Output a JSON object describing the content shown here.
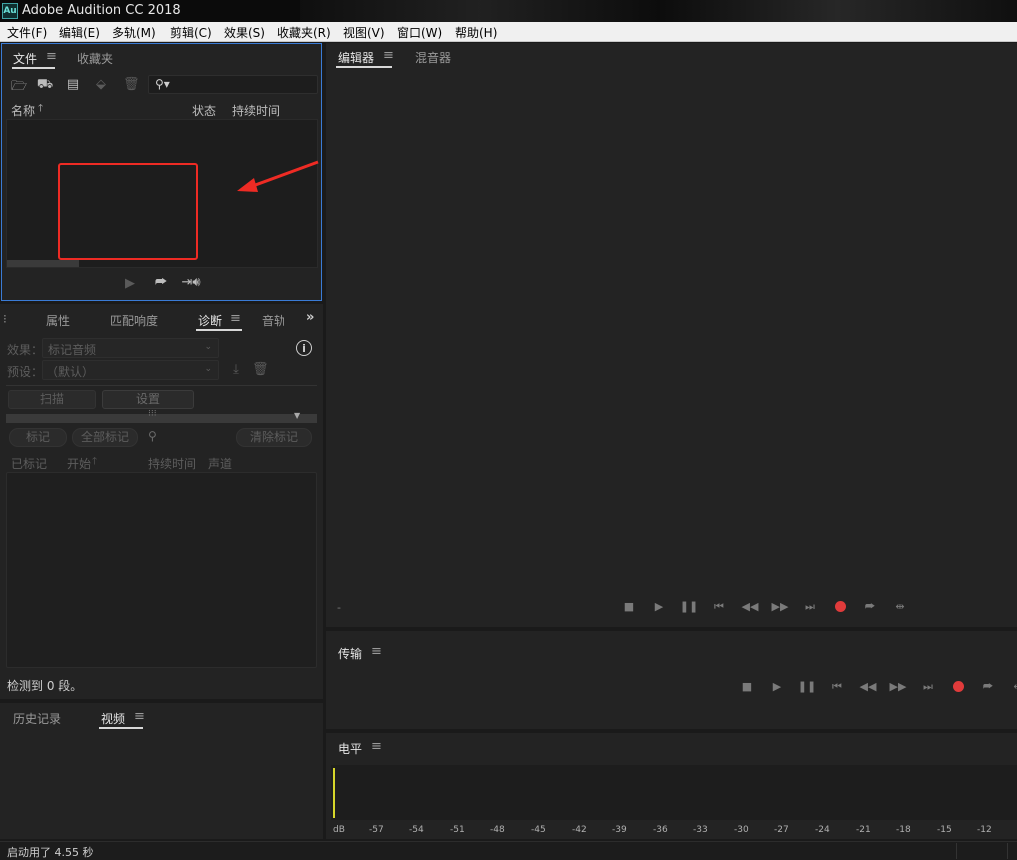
{
  "window": {
    "title": "Adobe Audition CC 2018",
    "logo_text": "Au"
  },
  "menu": [
    "文件(F)",
    "编辑(E)",
    "多轨(M)",
    "剪辑(C)",
    "效果(S)",
    "收藏夹(R)",
    "视图(V)",
    "窗口(W)",
    "帮助(H)"
  ],
  "files_panel": {
    "tabs": [
      "文件",
      "收藏夹"
    ],
    "columns": {
      "name": "名称",
      "status": "状态",
      "duration": "持续时间"
    }
  },
  "diag_panel": {
    "tabs": [
      "属性",
      "匹配响度",
      "诊断",
      "音轨"
    ],
    "effect_label": "效果：",
    "effect_value": "标记音频",
    "preset_label": "预设：",
    "preset_value": "（默认）",
    "scan_button": "扫描",
    "settings_button": "设置",
    "mark_button": "标记",
    "mark_all_button": "全部标记",
    "clear_marks_button": "清除标记",
    "columns": [
      "已标记",
      "开始",
      "持续时间",
      "声道"
    ],
    "status_text": "检测到 0 段。"
  },
  "history_panel": {
    "tabs": [
      "历史记录",
      "视频"
    ]
  },
  "editor_panel": {
    "tabs": [
      "编辑器",
      "混音器"
    ],
    "time_readout": "-"
  },
  "transport_panel": {
    "title": "传输"
  },
  "level_panel": {
    "title": "电平",
    "scale": [
      "dB",
      "-57",
      "-54",
      "-51",
      "-48",
      "-45",
      "-42",
      "-39",
      "-36",
      "-33",
      "-30",
      "-27",
      "-24",
      "-21",
      "-18",
      "-15",
      "-12"
    ]
  },
  "status_bar": {
    "text": "启动用了 4.55 秒"
  },
  "colors": {
    "accent_blue": "#3a7bd5",
    "record_red": "#e03b3b",
    "annotation_red": "#ee2b24",
    "meter_yellow": "#d6d62a"
  }
}
